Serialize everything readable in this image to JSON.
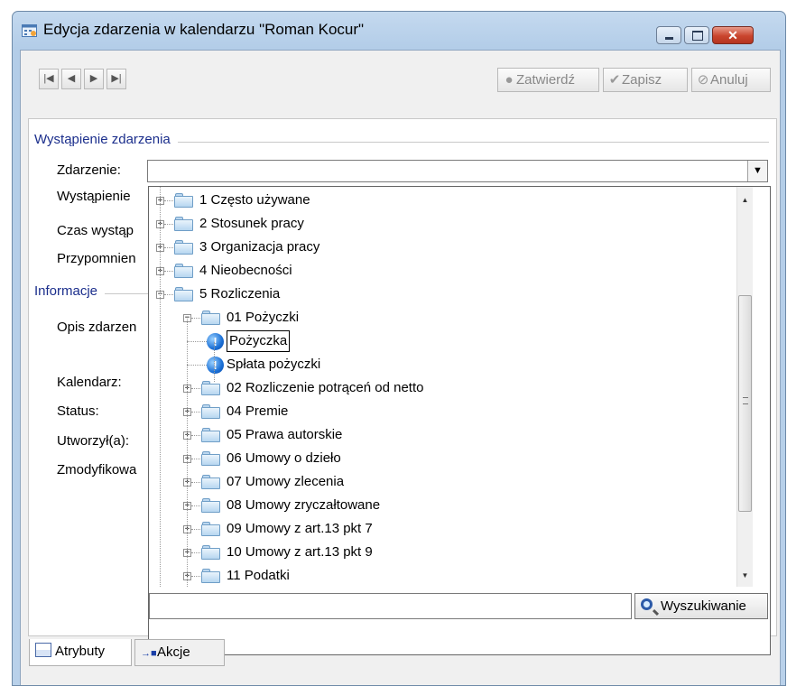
{
  "window": {
    "title": "Edycja zdarzenia w kalendarzu \"Roman Kocur\""
  },
  "toolbar": {
    "nav": [
      "|◀",
      "◀",
      "▶",
      "▶|"
    ],
    "confirm_label": "Zatwierdź",
    "save_label": "Zapisz",
    "cancel_label": "Anuluj"
  },
  "form": {
    "section1_title": "Wystąpienie zdarzenia",
    "section2_title": "Informacje",
    "labels": {
      "zdarzenie": "Zdarzenie:",
      "wystapienie": "Wystąpienie",
      "czas": "Czas wystąp",
      "przypomnienie": "Przypomnien",
      "opis": "Opis zdarzen",
      "kalendarz": "Kalendarz:",
      "status": "Status:",
      "utworzyl": "Utworzył(a):",
      "zmodyfikowal": "Zmodyfikowa"
    },
    "zdarzenie_value": ""
  },
  "tree": {
    "items": [
      {
        "label": "1 Często używane",
        "type": "folder",
        "expanded": false
      },
      {
        "label": "2 Stosunek pracy",
        "type": "folder",
        "expanded": false
      },
      {
        "label": "3 Organizacja pracy",
        "type": "folder",
        "expanded": false
      },
      {
        "label": "4 Nieobecności",
        "type": "folder",
        "expanded": false
      },
      {
        "label": "5 Rozliczenia",
        "type": "folder",
        "expanded": true
      },
      {
        "label": "01 Pożyczki",
        "type": "folder",
        "expanded": true
      },
      {
        "label": "Pożyczka",
        "type": "leaf",
        "selected": true
      },
      {
        "label": "Spłata pożyczki",
        "type": "leaf",
        "selected": false
      },
      {
        "label": "02 Rozliczenie potrąceń od netto",
        "type": "folder",
        "expanded": false
      },
      {
        "label": "04 Premie",
        "type": "folder",
        "expanded": false
      },
      {
        "label": "05 Prawa autorskie",
        "type": "folder",
        "expanded": false
      },
      {
        "label": "06 Umowy o dzieło",
        "type": "folder",
        "expanded": false
      },
      {
        "label": "07 Umowy zlecenia",
        "type": "folder",
        "expanded": false
      },
      {
        "label": "08 Umowy zryczałtowane",
        "type": "folder",
        "expanded": false
      },
      {
        "label": "09 Umowy z art.13 pkt 7",
        "type": "folder",
        "expanded": false
      },
      {
        "label": "10 Umowy z art.13 pkt 9",
        "type": "folder",
        "expanded": false
      },
      {
        "label": "11 Podatki",
        "type": "folder",
        "expanded": false
      }
    ],
    "search_value": "",
    "search_button": "Wyszukiwanie"
  },
  "tabs": [
    {
      "label": "Atrybuty",
      "active": true
    },
    {
      "label": "Akcje",
      "active": false
    }
  ]
}
